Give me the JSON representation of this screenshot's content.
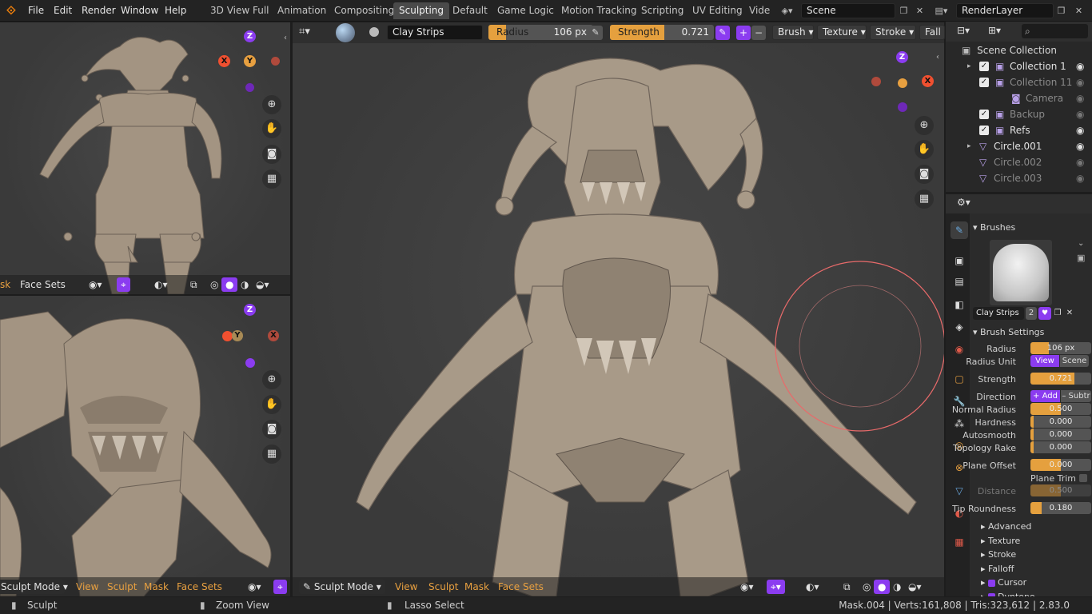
{
  "app_icon": "blender-icon",
  "menu": [
    "File",
    "Edit",
    "Render",
    "Window",
    "Help"
  ],
  "workspaces": [
    "3D View Full",
    "Animation",
    "Compositing",
    "Sculpting",
    "Default",
    "Game Logic",
    "Motion Tracking",
    "Scripting",
    "UV Editing",
    "Vide"
  ],
  "active_workspace": "Sculpting",
  "scene": {
    "label": "Scene"
  },
  "renderlayer": {
    "label": "RenderLayer"
  },
  "tool_header": {
    "brush_name": "Clay Strips",
    "radius_label": "Radius",
    "radius_value": "106 px",
    "strength_label": "Strength",
    "strength_value": "0.721",
    "strength_fraction": 0.721,
    "menus": [
      "Brush",
      "Texture",
      "Stroke",
      "Fall"
    ]
  },
  "left_top_view": {
    "header": [
      "sk",
      "Face Sets"
    ]
  },
  "left_bottom_view": {
    "header": [
      "Sculpt Mode",
      "View",
      "Sculpt",
      "Mask",
      "Face Sets"
    ]
  },
  "main_view": {
    "header": [
      "Sculpt Mode",
      "View",
      "Sculpt",
      "Mask",
      "Face Sets"
    ]
  },
  "gizmo": {
    "x": "X",
    "y": "Y",
    "z": "Z"
  },
  "outliner": {
    "root": "Scene Collection",
    "items": [
      {
        "label": "Collection 1",
        "dim": false
      },
      {
        "label": "Collection 11",
        "dim": true
      },
      {
        "label": "Camera",
        "dim": true
      },
      {
        "label": "Backup",
        "dim": true
      },
      {
        "label": "Refs",
        "dim": false
      },
      {
        "label": "Circle.001",
        "dim": false
      },
      {
        "label": "Circle.002",
        "dim": true
      },
      {
        "label": "Circle.003",
        "dim": true
      }
    ]
  },
  "properties": {
    "brushes_title": "Brushes",
    "brush_name": "Clay Strips",
    "brush_users": "2",
    "brush_settings_title": "Brush Settings",
    "radius": {
      "label": "Radius",
      "value": "106 px"
    },
    "radius_unit": {
      "label": "Radius Unit",
      "view": "View",
      "scene": "Scene"
    },
    "strength": {
      "label": "Strength",
      "value": "0.721",
      "fraction": 0.721
    },
    "direction": {
      "label": "Direction",
      "add": "+ Add",
      "subtract": "– Subtr"
    },
    "normal_radius": {
      "label": "Normal Radius",
      "value": "0.500",
      "fraction": 0.5
    },
    "hardness": {
      "label": "Hardness",
      "value": "0.000",
      "fraction": 0
    },
    "autosmooth": {
      "label": "Autosmooth",
      "value": "0.000",
      "fraction": 0
    },
    "topology_rake": {
      "label": "Topology Rake",
      "value": "0.000",
      "fraction": 0
    },
    "plane_offset": {
      "label": "Plane Offset",
      "value": "0.000",
      "fraction": 0.5
    },
    "plane_trim": "Plane Trim",
    "distance": {
      "label": "Distance",
      "value": "0.500",
      "fraction": 0.5
    },
    "tip_roundness": {
      "label": "Tip Roundness",
      "value": "0.180",
      "fraction": 0.18
    },
    "subpanels": [
      "Advanced",
      "Texture",
      "Stroke",
      "Falloff",
      "Cursor",
      "Dyntopo"
    ]
  },
  "statusbar": {
    "left": "Sculpt",
    "middle": "Zoom View",
    "right": "Lasso Select",
    "stats": "Mask.004 | Verts:161,808 | Tris:323,612 | 2.83.0"
  }
}
